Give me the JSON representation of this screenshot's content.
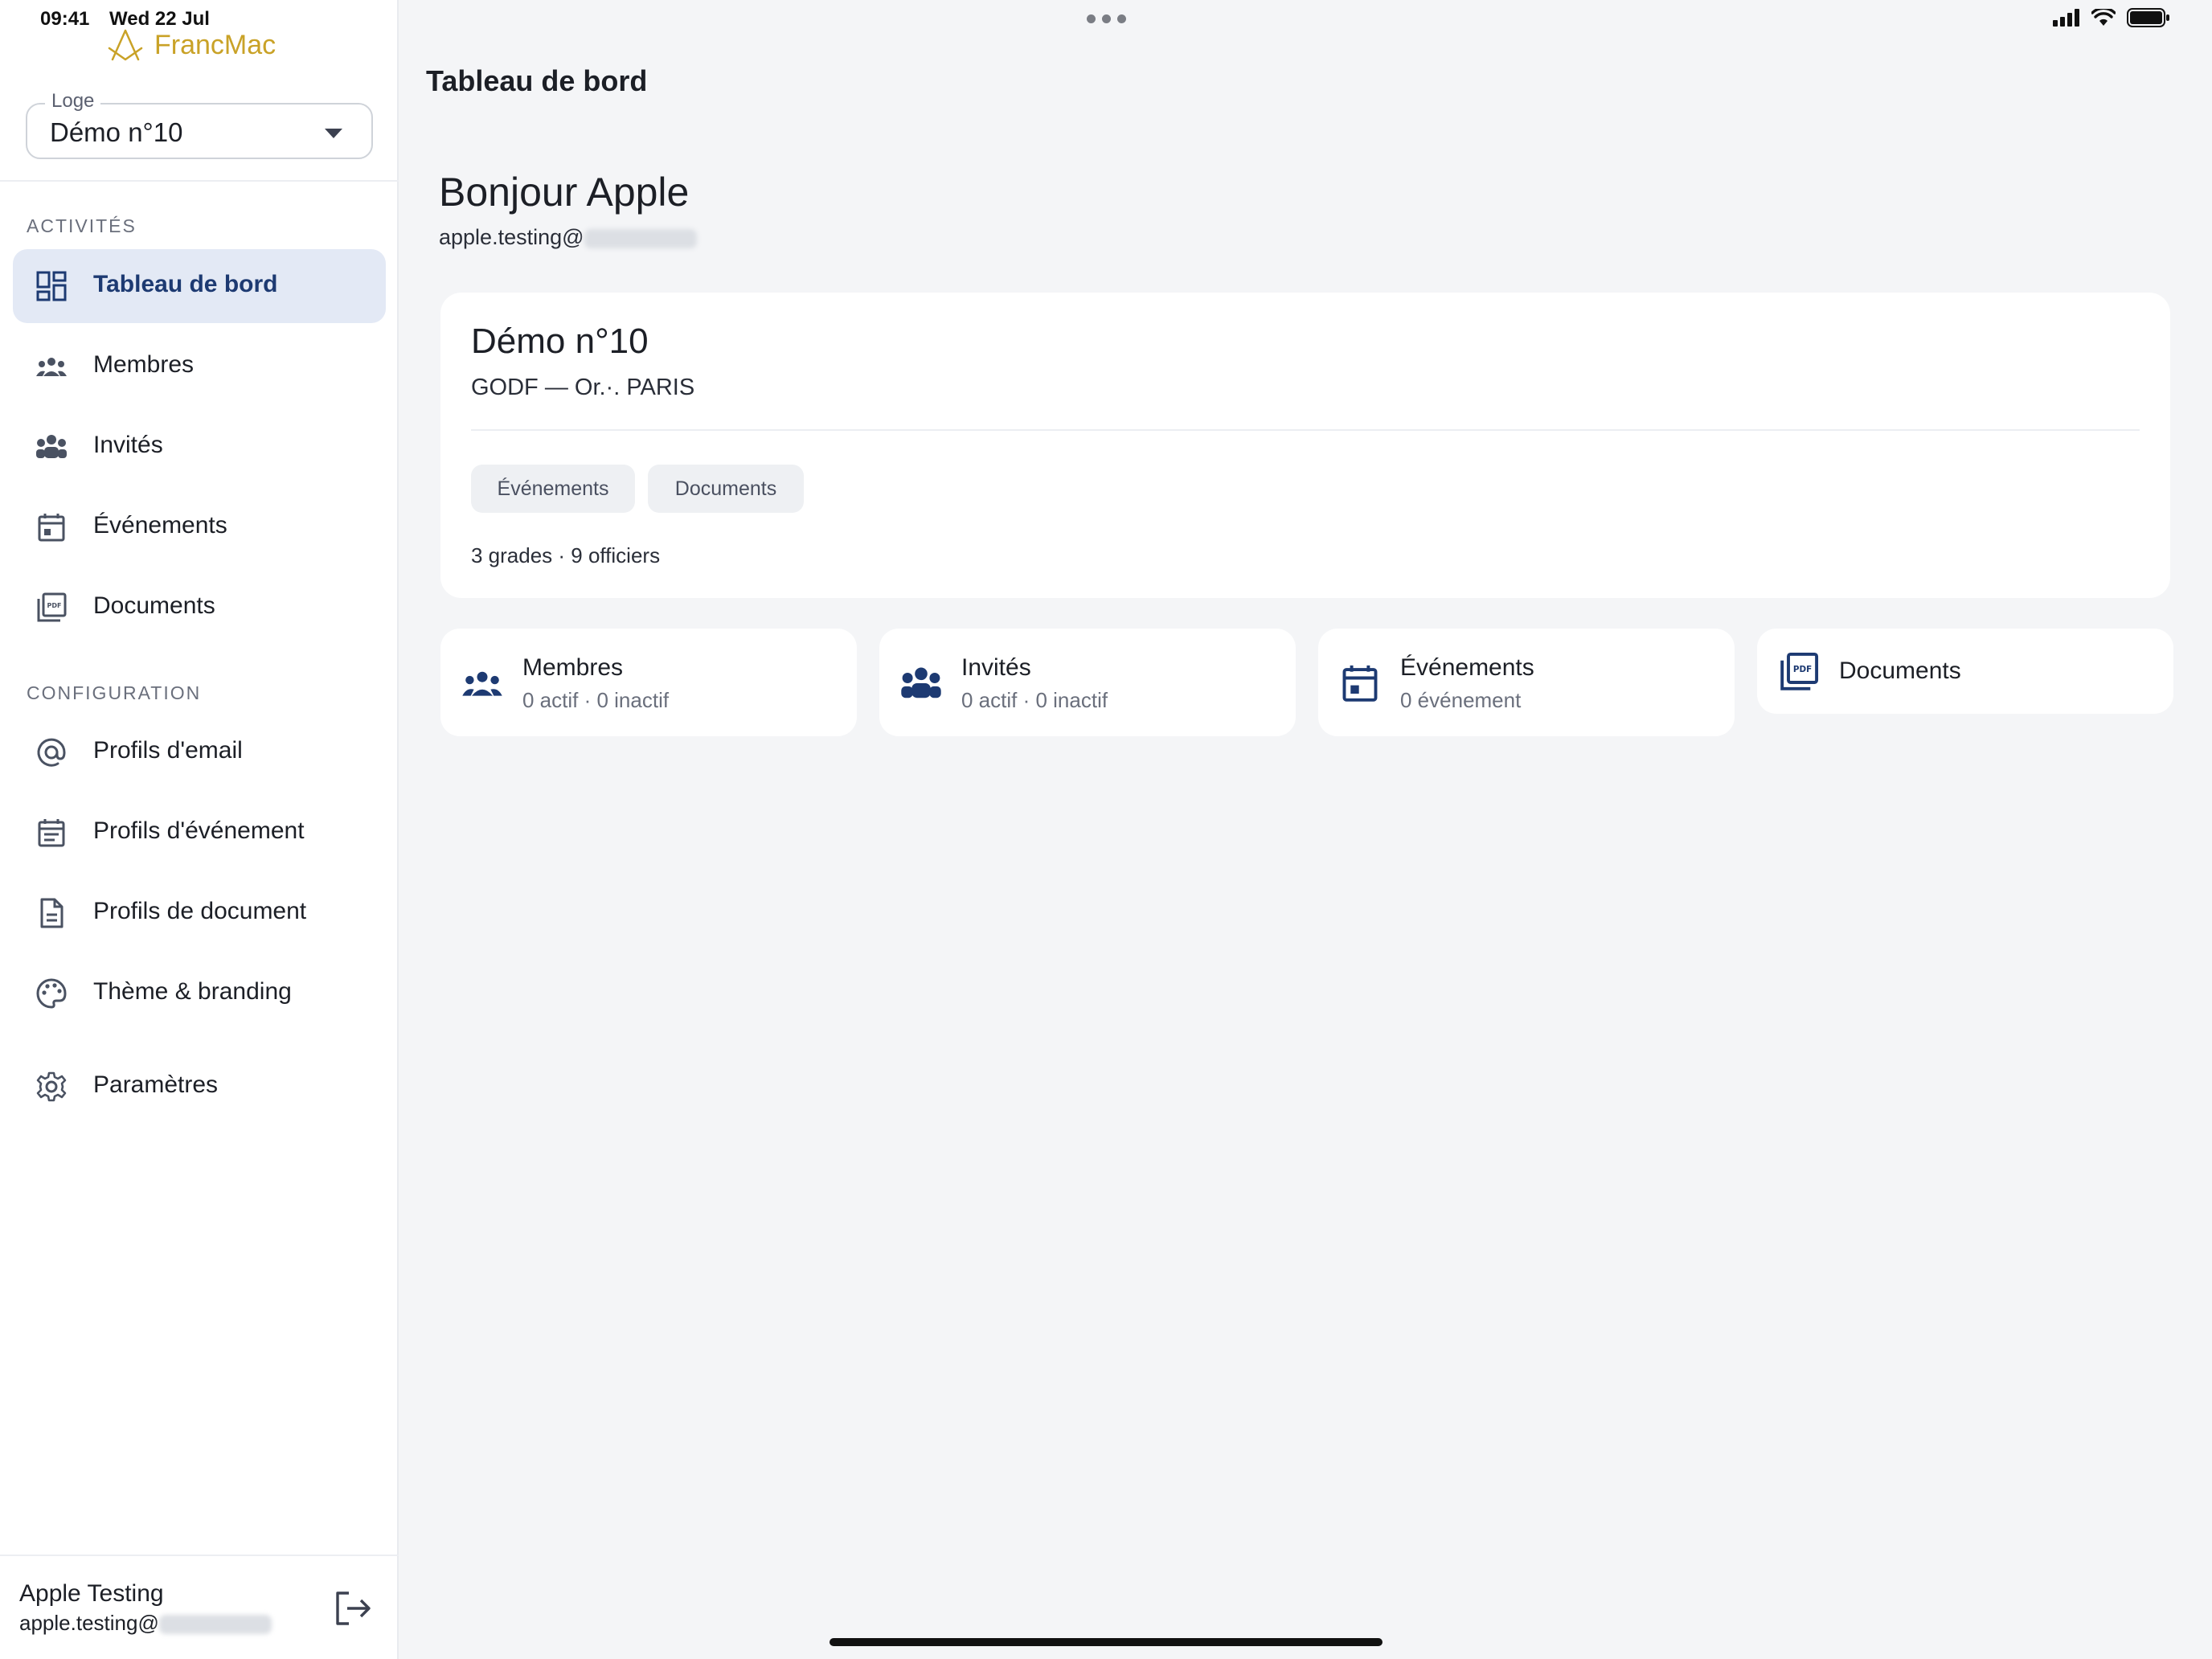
{
  "status_bar": {
    "time": "09:41",
    "date": "Wed 22 Jul"
  },
  "brand": {
    "name": "FrancMac",
    "color": "#c9a227",
    "icon": "compass-square-icon"
  },
  "loge_select": {
    "label": "Loge",
    "value": "Démo n°10"
  },
  "sidebar": {
    "section_activities": "ACTIVITÉS",
    "activities": [
      {
        "label": "Tableau de bord",
        "icon": "dashboard-icon",
        "active": true
      },
      {
        "label": "Membres",
        "icon": "members-icon"
      },
      {
        "label": "Invités",
        "icon": "guests-icon"
      },
      {
        "label": "Événements",
        "icon": "calendar-icon"
      },
      {
        "label": "Documents",
        "icon": "pdf-icon"
      }
    ],
    "section_configuration": "CONFIGURATION",
    "configuration": [
      {
        "label": "Profils d'email",
        "icon": "at-sign-icon"
      },
      {
        "label": "Profils d'événement",
        "icon": "calendar-list-icon"
      },
      {
        "label": "Profils de document",
        "icon": "document-icon"
      },
      {
        "label": "Thème & branding",
        "icon": "palette-icon"
      },
      {
        "label": "Paramètres",
        "icon": "gear-icon"
      }
    ],
    "footer": {
      "user_name": "Apple Testing",
      "user_email_prefix": "apple.testing@"
    }
  },
  "main": {
    "page_title": "Tableau de bord",
    "greeting": "Bonjour Apple",
    "email_prefix": "apple.testing@",
    "loge_card": {
      "title": "Démo n°10",
      "subtitle": "GODF — Or.·. PARIS",
      "chips": [
        "Événements",
        "Documents"
      ],
      "stats": "3 grades · 9 officiers"
    },
    "stat_cards": [
      {
        "title": "Membres",
        "subtitle": "0 actif · 0 inactif",
        "icon": "members-icon"
      },
      {
        "title": "Invités",
        "subtitle": "0 actif · 0 inactif",
        "icon": "guests-icon"
      },
      {
        "title": "Événements",
        "subtitle": "0 événement",
        "icon": "calendar-icon"
      },
      {
        "title": "Documents",
        "icon": "pdf-icon"
      }
    ]
  },
  "colors": {
    "accent": "#1d3a72",
    "active_bg": "#e3e9f5",
    "background": "#f4f5f7"
  }
}
